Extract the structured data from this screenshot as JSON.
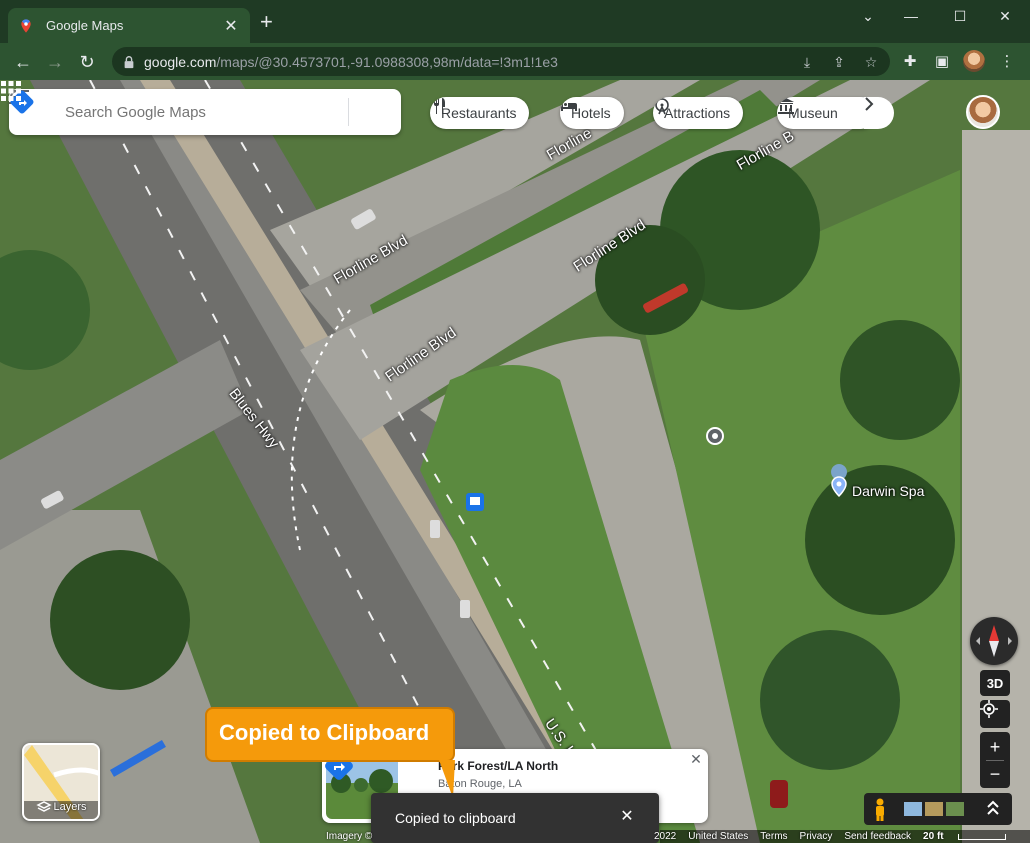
{
  "browser": {
    "tab_title": "Google Maps",
    "url_host": "google.com",
    "url_path": "/maps/@30.4573701,-91.0988308,98m/data=!3m1!1e3",
    "new_tab_label": "+",
    "minimize": "⌄",
    "restore": "—",
    "maximize": "☐",
    "close": "✕"
  },
  "search": {
    "placeholder": "Search Google Maps"
  },
  "chips": [
    {
      "label": "Restaurants"
    },
    {
      "label": "Hotels"
    },
    {
      "label": "Attractions"
    },
    {
      "label": "Museun"
    }
  ],
  "map_labels": {
    "florline_1": "Florline Blvd",
    "florline_2": "Florline Blvd",
    "florline_3": "Florline Blvd",
    "florline_4": "Florline B",
    "florline_5": "Florline",
    "blues_hwy": "Blues Hwy",
    "us_hwy": "U.S. H",
    "poi": "Darwin Spa"
  },
  "controls": {
    "three_d": "3D",
    "zoom_in": "+",
    "zoom_out": "−",
    "layers": "Layers"
  },
  "place_card": {
    "name": "Park Forest/LA North",
    "subtitle": "Baton Rouge, LA"
  },
  "toast": {
    "message": "Copied to clipboard",
    "close": "✕"
  },
  "overlay_bubble": {
    "text": "Copied to Clipboard"
  },
  "footer": {
    "imagery": "Imagery ©",
    "year": "2022",
    "country": "United States",
    "terms": "Terms",
    "privacy": "Privacy",
    "feedback": "Send feedback",
    "scale": "20 ft"
  },
  "colors": {
    "chrome_dark": "#1f3a24",
    "chrome_tab": "#2d5431",
    "google_blue": "#4285f4",
    "toast_bg": "#323232",
    "bubble_orange": "#f59a0b"
  }
}
